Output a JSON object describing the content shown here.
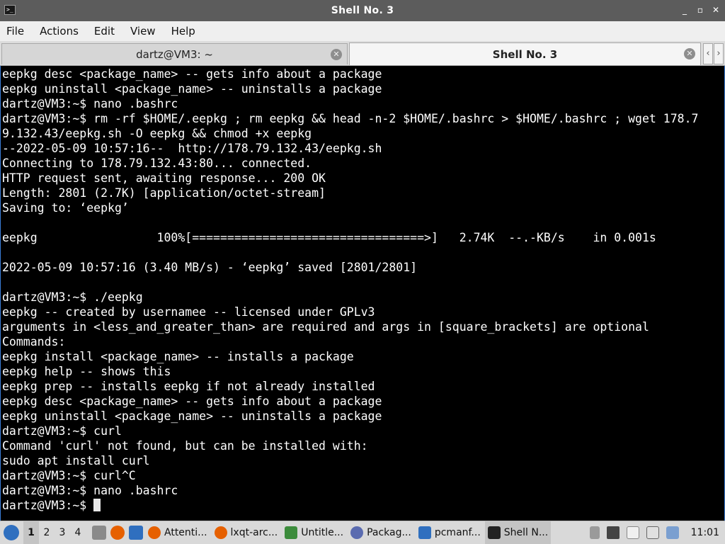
{
  "window": {
    "title": "Shell No. 3",
    "controls": [
      "_",
      "▫",
      "✕"
    ]
  },
  "menu": [
    "File",
    "Actions",
    "Edit",
    "View",
    "Help"
  ],
  "tabs": [
    {
      "label": "dartz@VM3: ~",
      "active": false
    },
    {
      "label": "Shell No. 3",
      "active": true
    }
  ],
  "tab_scroll": {
    "left": "‹",
    "right": "›"
  },
  "terminal": {
    "lines": [
      "eepkg desc <package_name> -- gets info about a package",
      "eepkg uninstall <package_name> -- uninstalls a package",
      "dartz@VM3:~$ nano .bashrc",
      "dartz@VM3:~$ rm -rf $HOME/.eepkg ; rm eepkg && head -n-2 $HOME/.bashrc > $HOME/.bashrc ; wget 178.7",
      "9.132.43/eepkg.sh -O eepkg && chmod +x eepkg",
      "--2022-05-09 10:57:16--  http://178.79.132.43/eepkg.sh",
      "Connecting to 178.79.132.43:80... connected.",
      "HTTP request sent, awaiting response... 200 OK",
      "Length: 2801 (2.7K) [application/octet-stream]",
      "Saving to: ‘eepkg’",
      "",
      "eepkg                 100%[=================================>]   2.74K  --.-KB/s    in 0.001s",
      "",
      "2022-05-09 10:57:16 (3.40 MB/s) - ‘eepkg’ saved [2801/2801]",
      "",
      "dartz@VM3:~$ ./eepkg",
      "eepkg -- created by usernamee -- licensed under GPLv3",
      "arguments in <less_and_greater_than> are required and args in [square_brackets] are optional",
      "Commands:",
      "eepkg install <package_name> -- installs a package",
      "eepkg help -- shows this",
      "eepkg prep -- installs eepkg if not already installed",
      "eepkg desc <package_name> -- gets info about a package",
      "eepkg uninstall <package_name> -- uninstalls a package",
      "dartz@VM3:~$ curl",
      "Command 'curl' not found, but can be installed with:",
      "sudo apt install curl",
      "dartz@VM3:~$ curl^C",
      "dartz@VM3:~$ nano .bashrc"
    ],
    "prompt": "dartz@VM3:~$ "
  },
  "taskbar": {
    "desktops": [
      "1",
      "2",
      "3",
      "4"
    ],
    "tasks": [
      {
        "label": "Attenti...",
        "icon": "firefox-icon",
        "color": "#e66000",
        "active": false
      },
      {
        "label": "lxqt-arc...",
        "icon": "firefox-icon",
        "color": "#e66000",
        "active": false
      },
      {
        "label": "Untitle...",
        "icon": "text-editor-icon",
        "color": "#3c8c3c",
        "active": false
      },
      {
        "label": "Packag...",
        "icon": "package-manager-icon",
        "color": "#5a6bb0",
        "active": false
      },
      {
        "label": "pcmanf...",
        "icon": "folder-icon",
        "color": "#2f6fbf",
        "active": false
      },
      {
        "label": "Shell N...",
        "icon": "terminal-icon",
        "color": "#222222",
        "active": true
      }
    ],
    "clock": "11:01"
  },
  "colors": {
    "titlebar": "#5c5c5c",
    "terminal_bg": "#000000",
    "terminal_fg": "#ffffff",
    "taskbar": "#d9d9d9"
  }
}
